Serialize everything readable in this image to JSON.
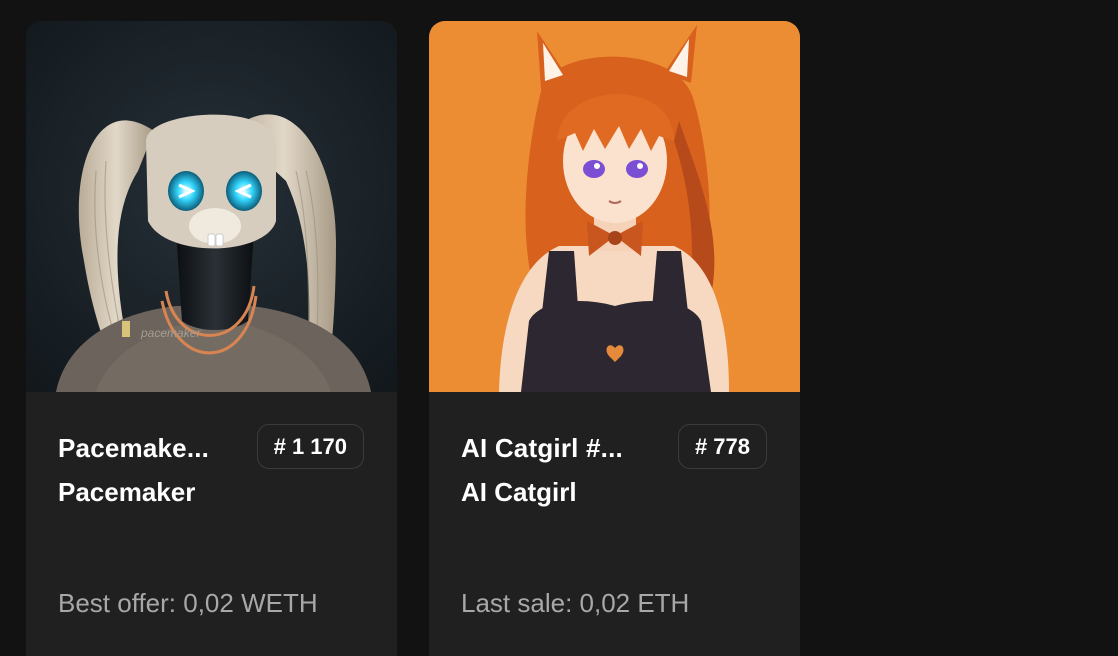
{
  "cards": [
    {
      "title": "Pacemaker #1170",
      "title_display": "Pacemake...",
      "collection": "Pacemaker",
      "badge": "# 1 170",
      "price_label": "Best offer: 0,02 WETH",
      "art_bg": "#1c2328",
      "art_text": "pacemaker"
    },
    {
      "title": "AI Catgirl #778",
      "title_display": "AI Catgirl #...",
      "collection": "AI Catgirl",
      "badge": "# 778",
      "price_label": "Last sale: 0,02 ETH",
      "art_bg": "#ee8d33"
    }
  ],
  "colors": {
    "page_bg": "#121212",
    "card_bg": "#202020",
    "badge_border": "#3b3b3b",
    "price_text": "#a8a8a8"
  }
}
